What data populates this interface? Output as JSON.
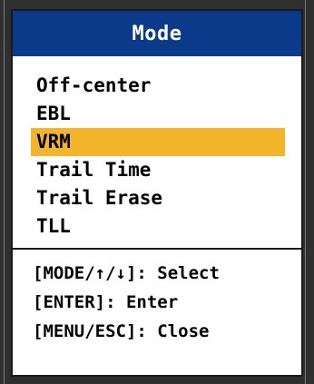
{
  "menu": {
    "title": "Mode",
    "selected_color": "#f2b52b",
    "title_bg_color": "#0b3a8a",
    "items": [
      {
        "label": "Off-center",
        "selected": false
      },
      {
        "label": "EBL",
        "selected": false
      },
      {
        "label": "VRM",
        "selected": true
      },
      {
        "label": "Trail Time",
        "selected": false
      },
      {
        "label": "Trail Erase",
        "selected": false
      },
      {
        "label": "TLL",
        "selected": false
      }
    ],
    "hints": [
      "[MODE/↑/↓]: Select",
      "[ENTER]: Enter",
      "[MENU/ESC]: Close"
    ]
  }
}
